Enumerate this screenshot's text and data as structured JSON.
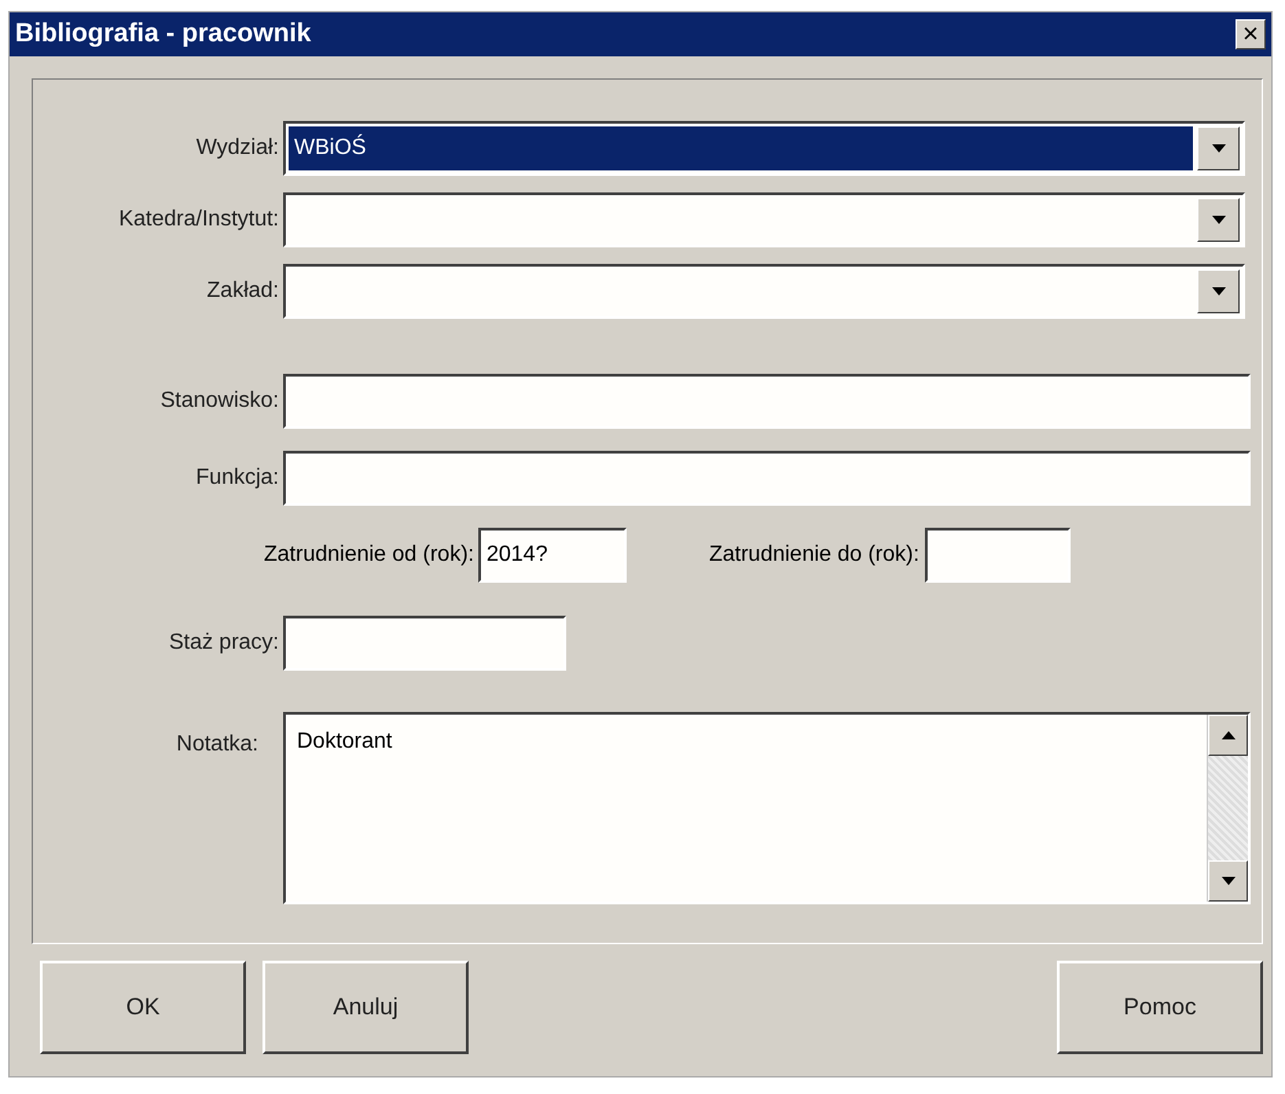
{
  "window": {
    "title": "Bibliografia - pracownik",
    "close": "×"
  },
  "dropdowns": [
    {
      "label": "Wydział:",
      "value": "WBiOŚ",
      "highlighted": true
    },
    {
      "label": "Katedra/Instytut:",
      "highlighted": false
    },
    {
      "label": "Zakład:",
      "highlighted": false
    }
  ],
  "fields": [
    {
      "label": "Stanowisko:"
    },
    {
      "label": "Funkcja:"
    }
  ],
  "employment": {
    "from_label": "Zatrudnienie od (rok):",
    "from_value": "2014?",
    "to_label": "Zatrudnienie do (rok):"
  },
  "seniority": {
    "label": "Staż pracy:"
  },
  "note": {
    "label": "Notatka:",
    "value": "Doktorant"
  },
  "buttons": [
    {
      "label": "OK"
    },
    {
      "label": "Anuluj"
    },
    {
      "label": "Pomoc"
    }
  ]
}
